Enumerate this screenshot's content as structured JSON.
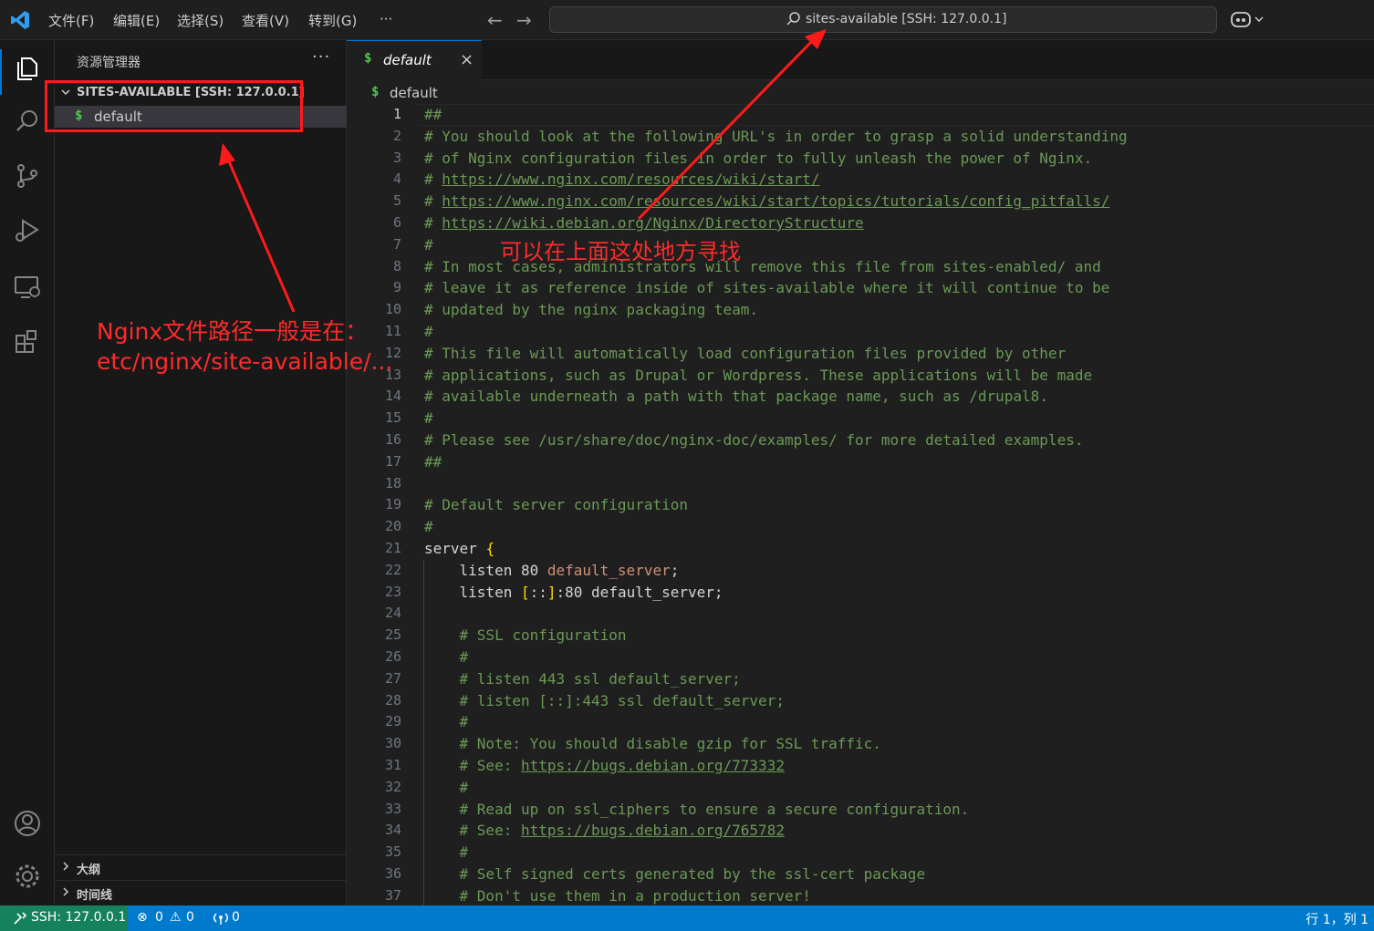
{
  "menu": [
    "文件(F)",
    "编辑(E)",
    "选择(S)",
    "查看(V)",
    "转到(G)",
    "···"
  ],
  "command_center": {
    "text": "sites-available [SSH: 127.0.0.1]"
  },
  "sidebar": {
    "title": "资源管理器",
    "more": "···",
    "folder": "SITES-AVAILABLE [SSH: 127.0.0.1]",
    "files": [
      {
        "icon": "$",
        "name": "default"
      }
    ],
    "outline": "大纲",
    "timeline": "时间线"
  },
  "tab": {
    "icon": "$",
    "name": "default",
    "close": "×"
  },
  "breadcrumb": {
    "icon": "$",
    "name": "default"
  },
  "editor": {
    "line_numbers": [
      "1",
      "2",
      "3",
      "4",
      "5",
      "6",
      "7",
      "8",
      "9",
      "10",
      "11",
      "12",
      "13",
      "14",
      "15",
      "16",
      "17",
      "18",
      "19",
      "20",
      "21",
      "22",
      "23",
      "24",
      "25",
      "26",
      "27",
      "28",
      "29",
      "30",
      "31",
      "32",
      "33",
      "34",
      "35",
      "36",
      "37"
    ],
    "lines": [
      "##",
      "# You should look at the following URL's in order to grasp a solid understanding",
      "# of Nginx configuration files in order to fully unleash the power of Nginx.",
      "# https://www.nginx.com/resources/wiki/start/",
      "# https://www.nginx.com/resources/wiki/start/topics/tutorials/config_pitfalls/",
      "# https://wiki.debian.org/Nginx/DirectoryStructure",
      "#",
      "# In most cases, administrators will remove this file from sites-enabled/ and",
      "# leave it as reference inside of sites-available where it will continue to be",
      "# updated by the nginx packaging team.",
      "#",
      "# This file will automatically load configuration files provided by other",
      "# applications, such as Drupal or Wordpress. These applications will be made",
      "# available underneath a path with that package name, such as /drupal8.",
      "#",
      "# Please see /usr/share/doc/nginx-doc/examples/ for more detailed examples.",
      "##",
      "",
      "# Default server configuration",
      "#",
      "server {",
      "    listen 80 default_server;",
      "    listen [::]:80 default_server;",
      "",
      "    # SSL configuration",
      "    #",
      "    # listen 443 ssl default_server;",
      "    # listen [::]:443 ssl default_server;",
      "    #",
      "    # Note: You should disable gzip for SSL traffic.",
      "    # See: https://bugs.debian.org/773332",
      "    #",
      "    # Read up on ssl_ciphers to ensure a secure configuration.",
      "    # See: https://bugs.debian.org/765782",
      "    #",
      "    # Self signed certs generated by the ssl-cert package",
      "    # Don't use them in a production server!"
    ]
  },
  "status": {
    "remote": "SSH: 127.0.0.1",
    "errors": "0",
    "warnings": "0",
    "ports": "0",
    "position": "行 1，列 1"
  },
  "annotations": {
    "top_note": "可以在上面这处地方寻找",
    "path_note_line1": "Nginx文件路径一般是在：",
    "path_note_line2": "etc/nginx/site-available/..."
  },
  "colors": {
    "accent": "#0078d4",
    "statusbar": "#007acc",
    "remote": "#16825d",
    "comment": "#6a9955",
    "annotation": "#ff2a2a"
  }
}
